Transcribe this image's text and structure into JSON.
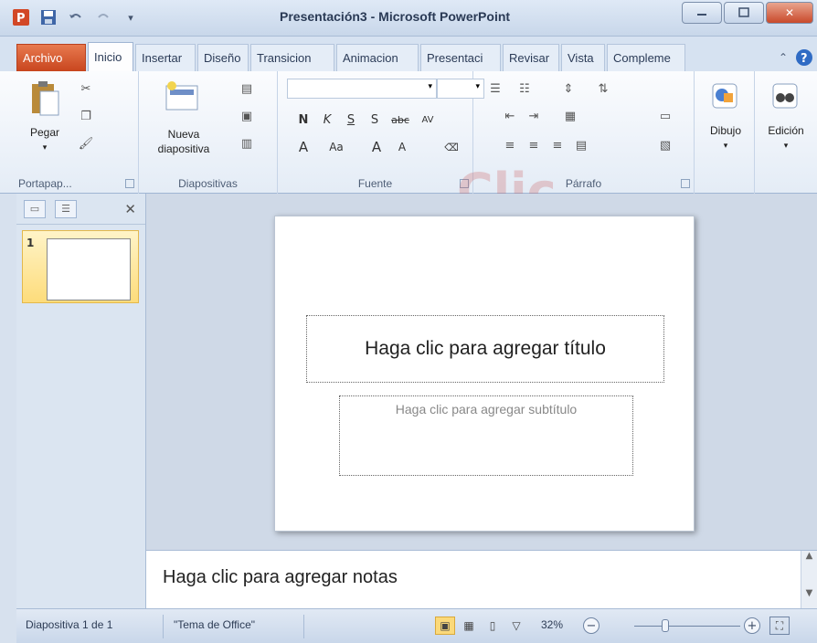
{
  "window": {
    "title": "Presentación3 - Microsoft PowerPoint"
  },
  "tabs": [
    {
      "label": "Archivo"
    },
    {
      "label": "Inicio"
    },
    {
      "label": "Insertar"
    },
    {
      "label": "Diseño"
    },
    {
      "label": "Transicion"
    },
    {
      "label": "Animacion"
    },
    {
      "label": "Presentaci"
    },
    {
      "label": "Revisar"
    },
    {
      "label": "Vista"
    },
    {
      "label": "Compleme"
    }
  ],
  "ribbon": {
    "clipboard": {
      "label": "Portapap...",
      "paste": "Pegar"
    },
    "slides": {
      "label": "Diapositivas",
      "new_slide_1": "Nueva",
      "new_slide_2": "diapositiva"
    },
    "font": {
      "label": "Fuente"
    },
    "paragraph": {
      "label": "Párrafo"
    },
    "drawing": {
      "label": "Dibujo"
    },
    "editing": {
      "label": "Edición"
    }
  },
  "thumbnails": [
    {
      "number": "1"
    }
  ],
  "slide": {
    "title_placeholder": "Haga clic para agregar título",
    "subtitle_placeholder": "Haga clic para agregar subtítulo"
  },
  "notes": {
    "placeholder": "Haga clic para agregar notas"
  },
  "statusbar": {
    "slide_info": "Diapositiva 1 de 1",
    "theme": "\"Tema de Office\"",
    "zoom": "32%"
  },
  "watermark": "Clic"
}
